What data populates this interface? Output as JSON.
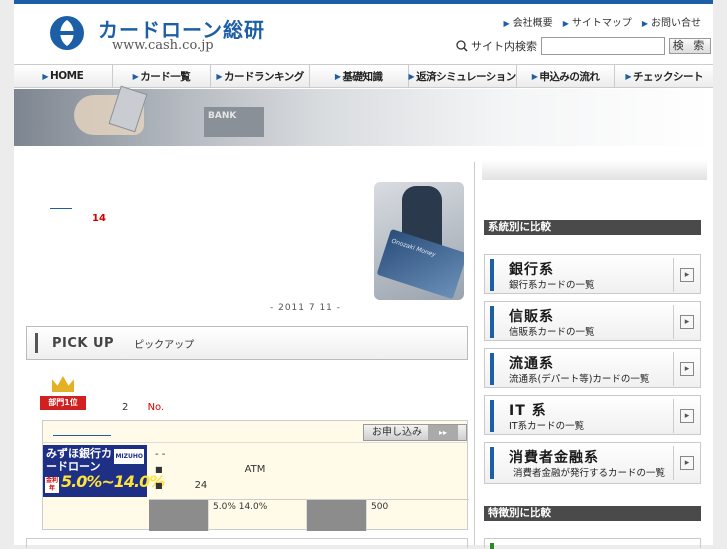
{
  "site": {
    "logo_text": "カードローン総研",
    "url": "www.cash.co.jp",
    "brand_color": "#1d5fa6"
  },
  "toplinks": [
    "会社概要",
    "サイトマップ",
    "お問い合せ"
  ],
  "search": {
    "label": "サイト内検索",
    "value": "",
    "button": "検 索"
  },
  "nav": [
    "HOME",
    "カード一覧",
    "カードランキング",
    "基礎知識",
    "返済シミュレーション",
    "申込みの流れ",
    "チェックシート"
  ],
  "intro": {
    "number": "14",
    "date": "- 2011 7 11 -"
  },
  "pickup": {
    "title_en": "PICK UP",
    "title_jp": "ピックアップ"
  },
  "ranking": {
    "badge": "部門1位",
    "rank": "2",
    "no_label": "No."
  },
  "card": {
    "apply_button": "お申し込み",
    "name": "みずほ銀行カードローン",
    "brand": "MIZUHO",
    "rate_tag": "金利 年",
    "rate": "5.0%~14.0%",
    "features": [
      "- -",
      "ATM",
      "24"
    ],
    "spec_rate": "5.0% 14.0%",
    "spec_limit": "500"
  },
  "sidebar": {
    "section1": "系統別に比較",
    "categories": [
      {
        "title": "銀行系",
        "sub": "銀行系カードの一覧"
      },
      {
        "title": "信販系",
        "sub": "信販系カードの一覧"
      },
      {
        "title": "流通系",
        "sub": "流通系(デパート等)カードの一覧"
      },
      {
        "title": "IT 系",
        "sub": "IT系カードの一覧"
      },
      {
        "title": "消費者金融系",
        "sub": "消費者金融が発行するカードの一覧"
      }
    ],
    "section2": "特徴別に比較"
  }
}
